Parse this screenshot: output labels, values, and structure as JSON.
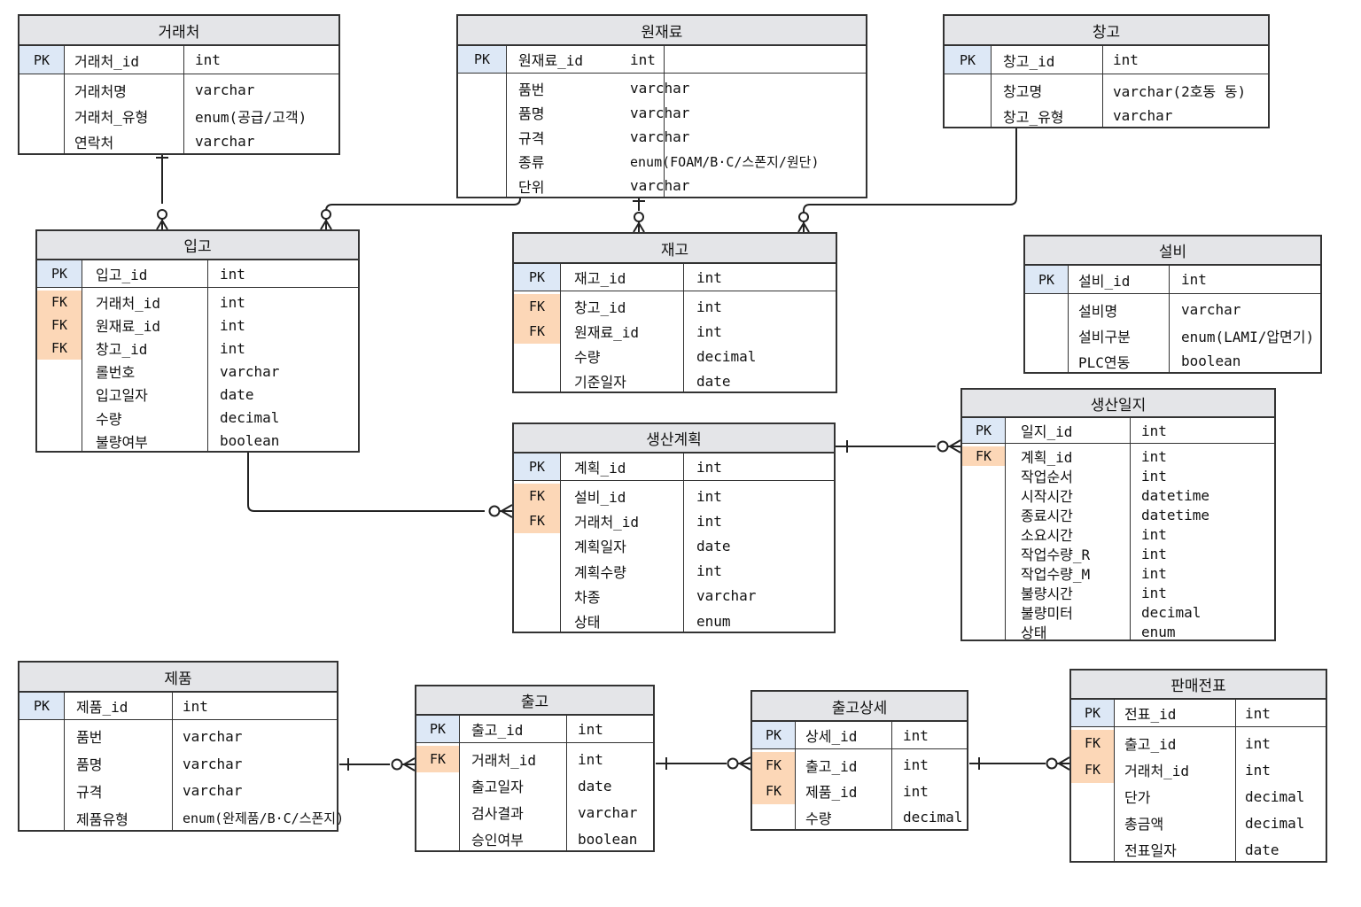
{
  "entities": {
    "vendor": {
      "title": "거래처",
      "rows": [
        {
          "key": "PK",
          "name": "거래처_id",
          "type": "int"
        },
        {
          "key": "",
          "name": "거래처명",
          "type": "varchar"
        },
        {
          "key": "",
          "name": "거래처_유형",
          "type": "enum(공급/고객)"
        },
        {
          "key": "",
          "name": "연락처",
          "type": "varchar"
        }
      ]
    },
    "material": {
      "title": "원재료",
      "rows": [
        {
          "key": "PK",
          "name": "원재료_id",
          "type": "int"
        },
        {
          "key": "",
          "name": "품번",
          "type": "varchar"
        },
        {
          "key": "",
          "name": "품명",
          "type": "varchar"
        },
        {
          "key": "",
          "name": "규격",
          "type": "varchar"
        },
        {
          "key": "",
          "name": "종류",
          "type": "enum(FOAM/B·C/스폰지/원단)"
        },
        {
          "key": "",
          "name": "단위",
          "type": "varchar"
        }
      ]
    },
    "warehouse": {
      "title": "창고",
      "rows": [
        {
          "key": "PK",
          "name": "창고_id",
          "type": "int"
        },
        {
          "key": "",
          "name": "창고명",
          "type": "varchar(2호동 동)"
        },
        {
          "key": "",
          "name": "창고_유형",
          "type": "varchar"
        }
      ]
    },
    "receiving": {
      "title": "입고",
      "rows": [
        {
          "key": "PK",
          "name": "입고_id",
          "type": "int"
        },
        {
          "key": "FK",
          "name": "거래처_id",
          "type": "int"
        },
        {
          "key": "FK",
          "name": "원재료_id",
          "type": "int"
        },
        {
          "key": "FK",
          "name": "창고_id",
          "type": "int"
        },
        {
          "key": "",
          "name": "롤번호",
          "type": "varchar"
        },
        {
          "key": "",
          "name": "입고일자",
          "type": "date"
        },
        {
          "key": "",
          "name": "수량",
          "type": "decimal"
        },
        {
          "key": "",
          "name": "불량여부",
          "type": "boolean"
        }
      ]
    },
    "inventory": {
      "title": "재고",
      "rows": [
        {
          "key": "PK",
          "name": "재고_id",
          "type": "int"
        },
        {
          "key": "FK",
          "name": "창고_id",
          "type": "int"
        },
        {
          "key": "FK",
          "name": "원재료_id",
          "type": "int"
        },
        {
          "key": "",
          "name": "수량",
          "type": "decimal"
        },
        {
          "key": "",
          "name": "기준일자",
          "type": "date"
        }
      ]
    },
    "equipment": {
      "title": "설비",
      "rows": [
        {
          "key": "PK",
          "name": "설비_id",
          "type": "int"
        },
        {
          "key": "",
          "name": "설비명",
          "type": "varchar"
        },
        {
          "key": "",
          "name": "설비구분",
          "type": "enum(LAMI/압면기)"
        },
        {
          "key": "",
          "name": "PLC연동",
          "type": "boolean"
        }
      ]
    },
    "plan": {
      "title": "생산계획",
      "rows": [
        {
          "key": "PK",
          "name": "계획_id",
          "type": "int"
        },
        {
          "key": "FK",
          "name": "설비_id",
          "type": "int"
        },
        {
          "key": "FK",
          "name": "거래처_id",
          "type": "int"
        },
        {
          "key": "",
          "name": "계획일자",
          "type": "date"
        },
        {
          "key": "",
          "name": "계획수량",
          "type": "int"
        },
        {
          "key": "",
          "name": "차종",
          "type": "varchar"
        },
        {
          "key": "",
          "name": "상태",
          "type": "enum"
        }
      ]
    },
    "log": {
      "title": "생산일지",
      "rows": [
        {
          "key": "PK",
          "name": "일지_id",
          "type": "int"
        },
        {
          "key": "FK",
          "name": "계획_id",
          "type": "int"
        },
        {
          "key": "",
          "name": "작업순서",
          "type": "int"
        },
        {
          "key": "",
          "name": "시작시간",
          "type": "datetime"
        },
        {
          "key": "",
          "name": "종료시간",
          "type": "datetime"
        },
        {
          "key": "",
          "name": "소요시간",
          "type": "int"
        },
        {
          "key": "",
          "name": "작업수량_R",
          "type": "int"
        },
        {
          "key": "",
          "name": "작업수량_M",
          "type": "int"
        },
        {
          "key": "",
          "name": "불량시간",
          "type": "int"
        },
        {
          "key": "",
          "name": "불량미터",
          "type": "decimal"
        },
        {
          "key": "",
          "name": "상태",
          "type": "enum"
        }
      ]
    },
    "product": {
      "title": "제품",
      "rows": [
        {
          "key": "PK",
          "name": "제품_id",
          "type": "int"
        },
        {
          "key": "",
          "name": "품번",
          "type": "varchar"
        },
        {
          "key": "",
          "name": "품명",
          "type": "varchar"
        },
        {
          "key": "",
          "name": "규격",
          "type": "varchar"
        },
        {
          "key": "",
          "name": "제품유형",
          "type": "enum(완제품/B·C/스폰지)"
        }
      ]
    },
    "shipment": {
      "title": "출고",
      "rows": [
        {
          "key": "PK",
          "name": "출고_id",
          "type": "int"
        },
        {
          "key": "FK",
          "name": "거래처_id",
          "type": "int"
        },
        {
          "key": "",
          "name": "출고일자",
          "type": "date"
        },
        {
          "key": "",
          "name": "검사결과",
          "type": "varchar"
        },
        {
          "key": "",
          "name": "승인여부",
          "type": "boolean"
        }
      ]
    },
    "shipment_detail": {
      "title": "출고상세",
      "rows": [
        {
          "key": "PK",
          "name": "상세_id",
          "type": "int"
        },
        {
          "key": "FK",
          "name": "출고_id",
          "type": "int"
        },
        {
          "key": "FK",
          "name": "제품_id",
          "type": "int"
        },
        {
          "key": "",
          "name": "수량",
          "type": "decimal"
        }
      ]
    },
    "sales_slip": {
      "title": "판매전표",
      "rows": [
        {
          "key": "PK",
          "name": "전표_id",
          "type": "int"
        },
        {
          "key": "FK",
          "name": "출고_id",
          "type": "int"
        },
        {
          "key": "FK",
          "name": "거래처_id",
          "type": "int"
        },
        {
          "key": "",
          "name": "단가",
          "type": "decimal"
        },
        {
          "key": "",
          "name": "총금액",
          "type": "decimal"
        },
        {
          "key": "",
          "name": "전표일자",
          "type": "date"
        }
      ]
    }
  },
  "relationships": [
    {
      "from": "vendor",
      "to": "receiving",
      "cardinality": "one-to-zero-or-many"
    },
    {
      "from": "material",
      "to": "receiving",
      "cardinality": "one-to-zero-or-many"
    },
    {
      "from": "material",
      "to": "inventory",
      "cardinality": "one-to-zero-or-many"
    },
    {
      "from": "warehouse",
      "to": "inventory",
      "cardinality": "one-to-zero-or-many"
    },
    {
      "from": "receiving",
      "to": "plan",
      "cardinality": "one-to-zero-or-many"
    },
    {
      "from": "plan",
      "to": "log",
      "cardinality": "one-to-zero-or-many"
    },
    {
      "from": "product",
      "to": "shipment",
      "cardinality": "one-to-zero-or-many"
    },
    {
      "from": "shipment",
      "to": "shipment_detail",
      "cardinality": "one-to-zero-or-many"
    },
    {
      "from": "shipment_detail",
      "to": "sales_slip",
      "cardinality": "one-to-zero-or-many"
    }
  ],
  "colors": {
    "pk_fill": "#dde8f6",
    "fk_fill": "#fcd7b7",
    "header_fill": "#e4e5e8",
    "line": "#222222"
  }
}
